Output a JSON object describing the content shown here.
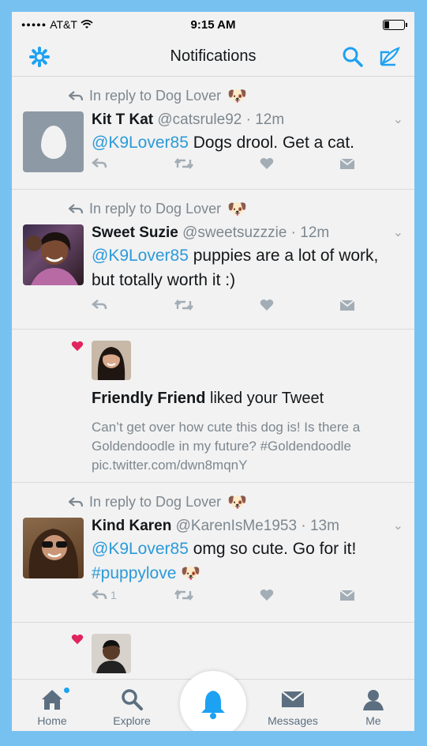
{
  "status": {
    "carrier": "AT&T",
    "time": "9:15 AM"
  },
  "header": {
    "title": "Notifications"
  },
  "colors": {
    "accent": "#1da1f2",
    "like": "#e0245e",
    "link": "#2b9ad9"
  },
  "feed": [
    {
      "type": "reply",
      "reply_to": "In reply to Dog Lover",
      "name": "Kit T Kat",
      "handle": "@catsrule92",
      "time": "· 12m",
      "mention": "@K9Lover85",
      "text": "Dogs drool. Get a cat.",
      "avatar": "egg-avatar"
    },
    {
      "type": "reply",
      "reply_to": "In reply to Dog Lover",
      "name": "Sweet Suzie",
      "handle": "@sweetsuzzzie",
      "time": "· 12m",
      "mention": "@K9Lover85",
      "text": "puppies are a lot of work, but totally worth it :)",
      "avatar": "photo-avatar"
    },
    {
      "type": "like",
      "name": "Friendly Friend",
      "action": "liked your Tweet",
      "tweet": "Can’t get over how cute this dog is! Is there a Goldendoodle in my future? #Goldendoodle pic.twitter.com/dwn8mqnY"
    },
    {
      "type": "reply",
      "reply_to": "In reply to Dog Lover",
      "name": "Kind Karen",
      "handle": "@KarenIsMe1953",
      "time": "· 13m",
      "mention": "@K9Lover85",
      "text": "omg so cute. Go for it!",
      "hashtag": "#puppylove",
      "reply_count": "1"
    },
    {
      "type": "like"
    }
  ],
  "tabs": [
    {
      "label": "Home",
      "icon": "home-icon"
    },
    {
      "label": "Explore",
      "icon": "search-icon"
    },
    {
      "label": "",
      "icon": "bell-icon"
    },
    {
      "label": "Messages",
      "icon": "envelope-icon"
    },
    {
      "label": "Me",
      "icon": "person-icon"
    }
  ]
}
